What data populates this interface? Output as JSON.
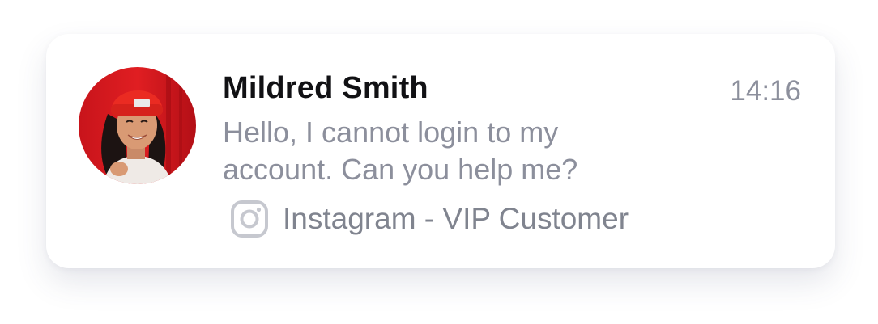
{
  "notification": {
    "sender_name": "Mildred Smith",
    "time": "14:16",
    "message": "Hello, I cannot login to my account. Can you help me?",
    "channel_label": "Instagram - VIP Customer",
    "channel_icon": "instagram-icon",
    "avatar_icon": "user-avatar"
  },
  "colors": {
    "name_text": "#111114",
    "secondary_text": "#8c8f9c",
    "card_background": "#ffffff"
  }
}
